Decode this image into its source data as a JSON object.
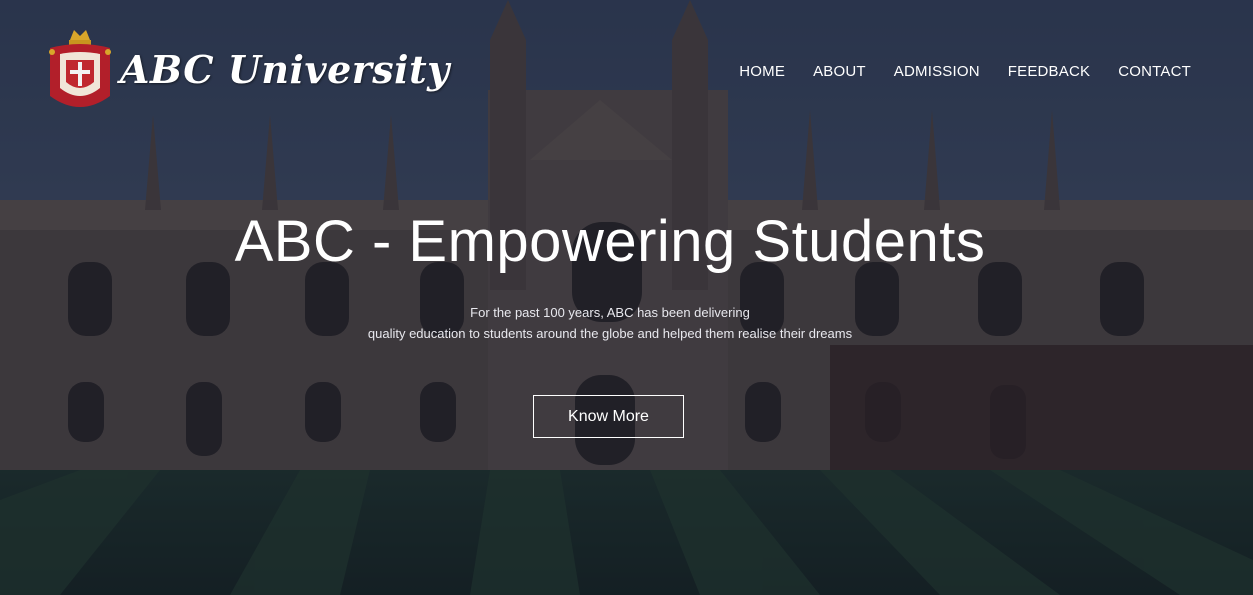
{
  "brand": {
    "name": "ABC University"
  },
  "nav": {
    "items": [
      "HOME",
      "ABOUT",
      "ADMISSION",
      "FEEDBACK",
      "CONTACT"
    ]
  },
  "hero": {
    "headline": "ABC - Empowering Students",
    "subtitle_line1": "For the past 100 years, ABC has been delivering",
    "subtitle_line2": "quality education to students around the globe and helped them realise their dreams",
    "cta_label": "Know More"
  },
  "colors": {
    "overlay": "#141a2c",
    "text": "#ffffff",
    "lawn": "#1f3a2a",
    "building": "#6b5a4f"
  }
}
